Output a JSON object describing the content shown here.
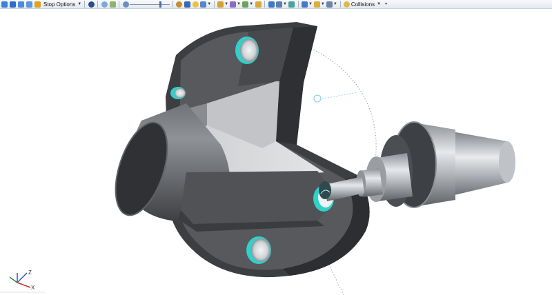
{
  "toolbar": {
    "stop_options_label": "Stop Options",
    "collisions_label": "Collisions",
    "slider_position": 0.78,
    "buttons": [
      {
        "icon": "step-back-icon"
      },
      {
        "icon": "stop-icon"
      },
      {
        "icon": "rewind-icon"
      },
      {
        "icon": "play-icon"
      },
      {
        "icon": "stop-options-icon"
      }
    ]
  },
  "triad": {
    "z_label": "Z",
    "x_label": "X"
  },
  "colors": {
    "part_dark": "#3a3c3f",
    "part_face": "#5d6064",
    "part_light": "#d4d6d9",
    "hole_cyan": "#39d6d0",
    "holder_silver": "#c9ccd0",
    "path_dotted": "#9aa1ab"
  }
}
